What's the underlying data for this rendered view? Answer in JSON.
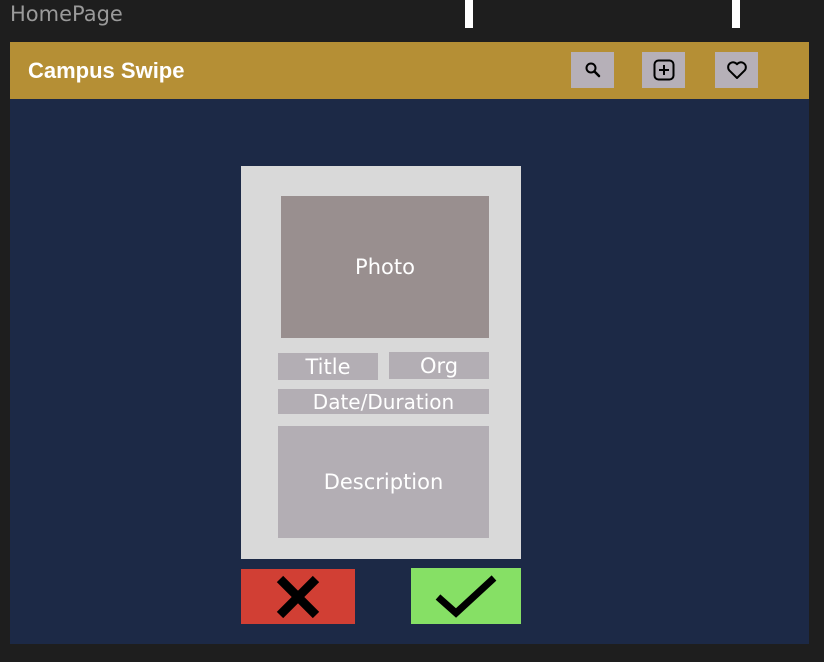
{
  "frame": {
    "label": "HomePage"
  },
  "header": {
    "title": "Campus Swipe",
    "buttons": [
      {
        "name": "search-button",
        "icon": "search-icon"
      },
      {
        "name": "add-button",
        "icon": "plus-square-icon"
      },
      {
        "name": "favorites-button",
        "icon": "heart-icon"
      }
    ]
  },
  "card": {
    "photo": "Photo",
    "title": "Title",
    "org": "Org",
    "date": "Date/Duration",
    "description": "Description"
  },
  "actions": {
    "reject_icon": "x-icon",
    "accept_icon": "check-icon"
  },
  "colors": {
    "header": "#b58f35",
    "background": "#1c2946",
    "card": "#d9d9d9",
    "reject": "#d13f34",
    "accept": "#86e065"
  }
}
